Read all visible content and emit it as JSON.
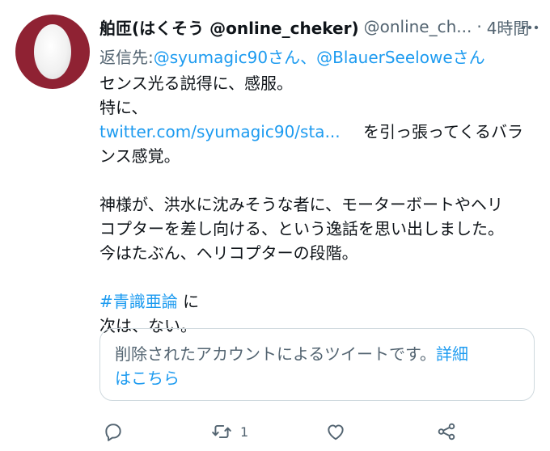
{
  "tweet": {
    "display_name": "舶匝(はくそう @online_cheker)",
    "handle": "@online_ch...",
    "separator": "·",
    "time": "4時間",
    "reply_prefix": "返信先: ",
    "reply_user_1": "@syumagic90さん",
    "reply_join": "、",
    "reply_user_2": "@BlauerSeeloweさん",
    "body": {
      "line1": "センス光る説得に、感服。",
      "line2": "特に、",
      "link": "twitter.com/syumagic90/sta...",
      "line3_after_link": "を引っ張ってくるバラ",
      "line4": "ンス感覚。",
      "line5": "神様が、洪水に沈みそうな者に、モーターボートやヘリ",
      "line6": "コプターを差し向ける、という逸話を思い出しました。",
      "line7": "今はたぶん、ヘリコプターの段階。",
      "hashtag": "#青識亜論",
      "hashtag_after": " に",
      "line9": "次は、ない。"
    },
    "quote": {
      "text": "削除されたアカウントによるツイートです。",
      "link_part1": "詳細",
      "link_part2": "はこちら"
    },
    "actions": {
      "reply_icon": "reply-icon",
      "retweet_icon": "retweet-icon",
      "retweet_count": "1",
      "like_icon": "heart-icon",
      "share_icon": "share-icon"
    },
    "colors": {
      "link": "#1d9bf0",
      "secondary": "#536471",
      "avatar": "#8f2233"
    }
  }
}
